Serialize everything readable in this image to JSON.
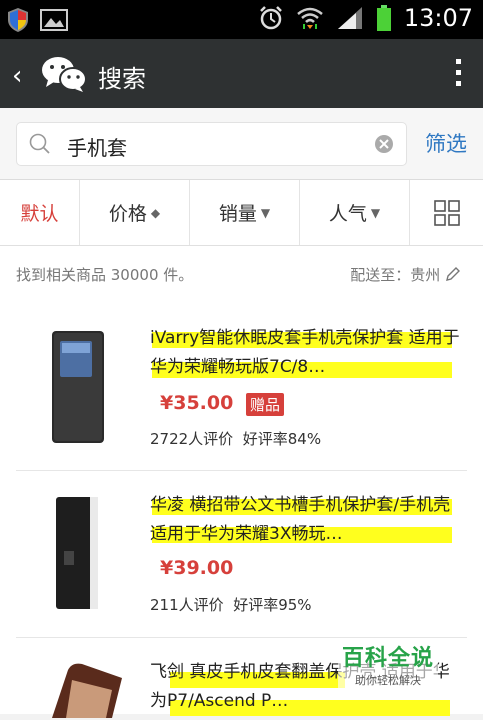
{
  "status_bar": {
    "time": "13:07"
  },
  "header": {
    "title": "搜索"
  },
  "search": {
    "query": "手机套",
    "filter_label": "筛选"
  },
  "sort_tabs": [
    {
      "label": "默认",
      "active": true
    },
    {
      "label": "价格",
      "arrow": "◆"
    },
    {
      "label": "销量",
      "arrow": "▼"
    },
    {
      "label": "人气",
      "arrow": "▼"
    }
  ],
  "result_info": {
    "found_text": "找到相关商品 30000 件。",
    "deliver_text": "配送至：贵州"
  },
  "products": [
    {
      "name": "iVarry智能休眠皮套手机壳保护套 适用于华为荣耀畅玩版7C/8…",
      "price": "¥35.00",
      "badge": "赠品",
      "reviews": "2722人评价",
      "rating": "好评率84%"
    },
    {
      "name": "华凌 横招带公文书槽手机保护套/手机壳 适用于华为荣耀3X畅玩…",
      "price": "¥39.00",
      "reviews": "211人评价",
      "rating": "好评率95%"
    },
    {
      "name": "飞剑 真皮手机皮套翻盖保护壳 适用于华为P7/Ascend P…"
    }
  ],
  "watermark": {
    "title": "百科全说",
    "subtitle": "助你轻松解决"
  }
}
